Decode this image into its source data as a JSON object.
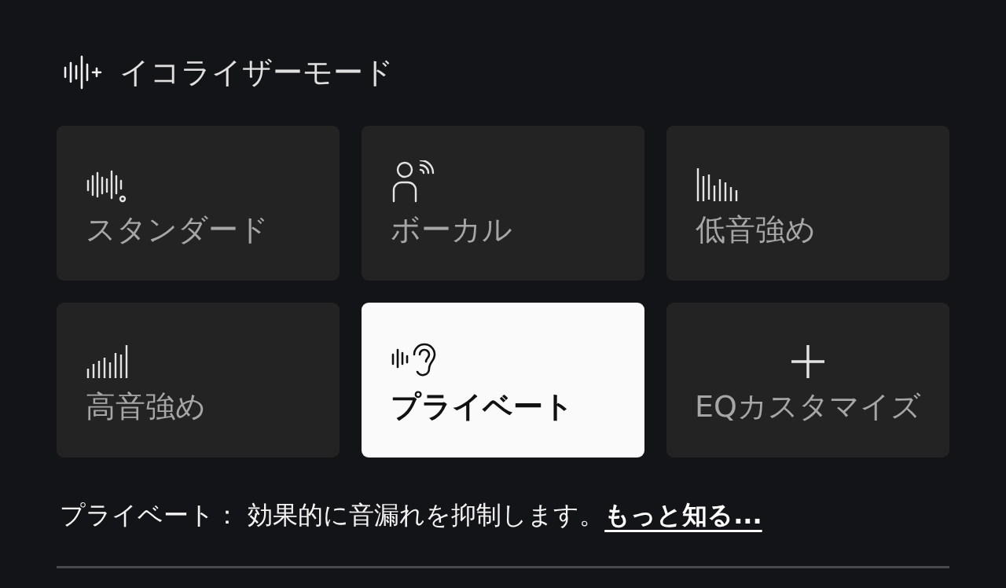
{
  "section": {
    "title": "イコライザーモード"
  },
  "modes": [
    {
      "label": "スタンダード",
      "kind": "standard",
      "selected": false
    },
    {
      "label": "ボーカル",
      "kind": "vocal",
      "selected": false
    },
    {
      "label": "低音強め",
      "kind": "bass",
      "selected": false
    },
    {
      "label": "高音強め",
      "kind": "treble",
      "selected": false
    },
    {
      "label": "プライベート",
      "kind": "private",
      "selected": true
    },
    {
      "label": "EQカスタマイズ",
      "kind": "custom",
      "selected": false
    }
  ],
  "description": {
    "text": "プライベート： 効果的に音漏れを抑制します。",
    "link": "もっと知る..."
  }
}
